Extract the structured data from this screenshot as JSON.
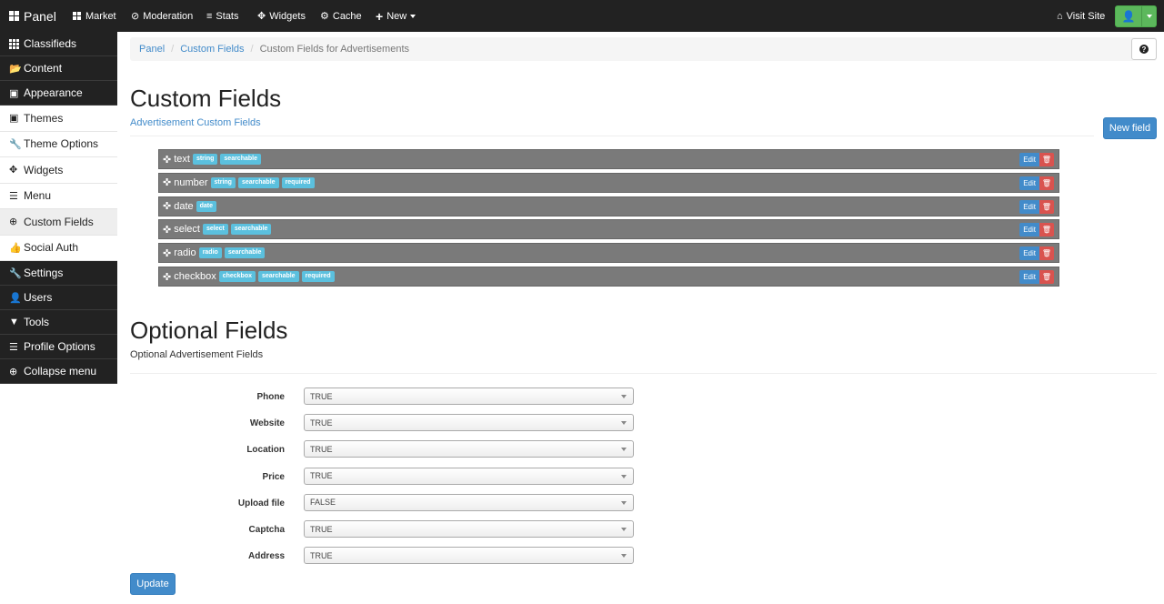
{
  "navbar": {
    "brand": "Panel",
    "items": [
      {
        "label": "Market",
        "icon": "th-large-icon"
      },
      {
        "label": "Moderation",
        "icon": "ban-icon"
      },
      {
        "label": "Stats",
        "icon": "align-left-icon"
      },
      {
        "label": "Widgets",
        "icon": "move-icon"
      },
      {
        "label": "Cache",
        "icon": "cog-icon"
      },
      {
        "label": "New",
        "icon": "plus-icon"
      }
    ],
    "visit_site": "Visit Site",
    "accent_green": "#5cb85c"
  },
  "sidebar": {
    "items": [
      {
        "label": "Classifieds",
        "icon": "grid-icon"
      },
      {
        "label": "Content",
        "icon": "folder-open-icon"
      },
      {
        "label": "Appearance",
        "icon": "picture-icon"
      },
      {
        "label": "Themes",
        "icon": "picture-icon"
      },
      {
        "label": "Theme Options",
        "icon": "wrench-icon"
      },
      {
        "label": "Widgets",
        "icon": "move-icon"
      },
      {
        "label": "Menu",
        "icon": "list-icon"
      },
      {
        "label": "Custom Fields",
        "icon": "plus-sign-icon"
      },
      {
        "label": "Social Auth",
        "icon": "thumbs-up-icon"
      },
      {
        "label": "Settings",
        "icon": "wrench-icon"
      },
      {
        "label": "Users",
        "icon": "user-icon"
      },
      {
        "label": "Tools",
        "icon": "filter-icon"
      },
      {
        "label": "Profile Options",
        "icon": "align-justify-icon"
      },
      {
        "label": "Collapse menu",
        "icon": "plus-sign-icon"
      }
    ]
  },
  "breadcrumb": {
    "items": [
      "Panel",
      "Custom Fields"
    ],
    "current": "Custom Fields for Advertisements"
  },
  "custom_fields": {
    "title": "Custom Fields",
    "subtitle": "Advertisement Custom Fields",
    "new_button": "New field",
    "edit_label": "Edit",
    "fields": [
      {
        "name": "text",
        "tags": [
          "string",
          "searchable"
        ]
      },
      {
        "name": "number",
        "tags": [
          "string",
          "searchable",
          "required"
        ]
      },
      {
        "name": "date",
        "tags": [
          "date"
        ]
      },
      {
        "name": "select",
        "tags": [
          "select",
          "searchable"
        ]
      },
      {
        "name": "radio",
        "tags": [
          "radio",
          "searchable"
        ]
      },
      {
        "name": "checkbox",
        "tags": [
          "checkbox",
          "searchable",
          "required"
        ]
      }
    ]
  },
  "optional_fields": {
    "title": "Optional Fields",
    "subtitle": "Optional Advertisement Fields",
    "rows": [
      {
        "label": "Phone",
        "value": "TRUE"
      },
      {
        "label": "Website",
        "value": "TRUE"
      },
      {
        "label": "Location",
        "value": "TRUE"
      },
      {
        "label": "Price",
        "value": "TRUE"
      },
      {
        "label": "Upload file",
        "value": "FALSE"
      },
      {
        "label": "Captcha",
        "value": "TRUE"
      },
      {
        "label": "Address",
        "value": "TRUE"
      }
    ],
    "update_button": "Update"
  }
}
